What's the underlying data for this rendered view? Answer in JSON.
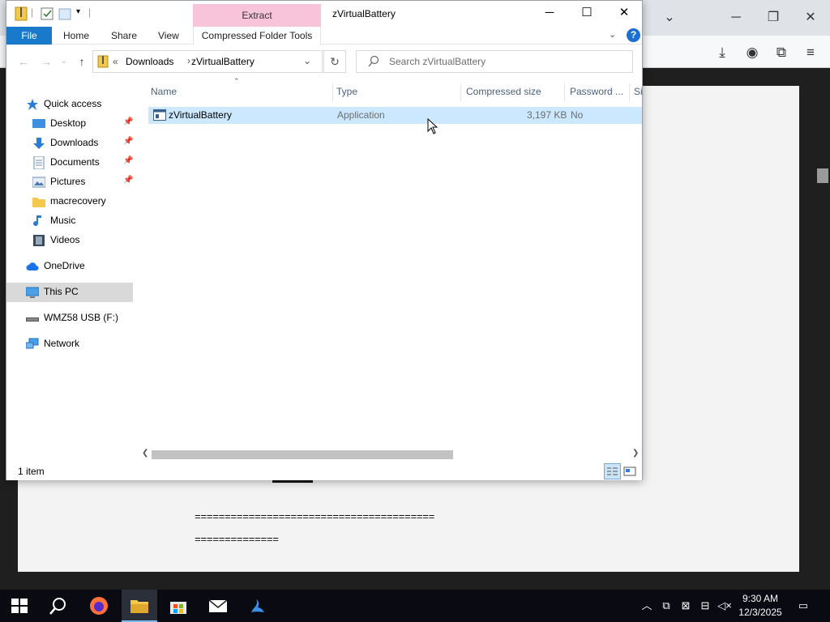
{
  "explorer": {
    "window_title": "zVirtualBattery",
    "context_tab": "Extract",
    "ribbon_tabs": {
      "file": "File",
      "home": "Home",
      "share": "Share",
      "view": "View",
      "compressed": "Compressed Folder Tools"
    },
    "address": {
      "chevron": "«",
      "segments": [
        "Downloads",
        "zVirtualBattery"
      ],
      "separator": "›"
    },
    "search": {
      "placeholder": "Search zVirtualBattery"
    },
    "nav": {
      "quick_access": "Quick access",
      "items": [
        "Desktop",
        "Downloads",
        "Documents",
        "Pictures",
        "macrecovery",
        "Music",
        "Videos"
      ],
      "onedrive": "OneDrive",
      "this_pc": "This PC",
      "usb": "WMZ58 USB (F:)",
      "network": "Network"
    },
    "columns": [
      "Name",
      "Type",
      "Compressed size",
      "Password ...",
      "Si"
    ],
    "files": [
      {
        "name": "zVirtualBattery",
        "type": "Application",
        "size": "3,197 KB",
        "password": "No"
      }
    ],
    "status": "1 item"
  },
  "background": {
    "line1": "========================================",
    "line2": "=============="
  },
  "taskbar": {
    "time": "9:30 AM",
    "date": "12/3/2025"
  },
  "colors": {
    "accent": "#1979ca",
    "extract_tab": "#f8c4d9",
    "selection": "#cce8ff"
  }
}
